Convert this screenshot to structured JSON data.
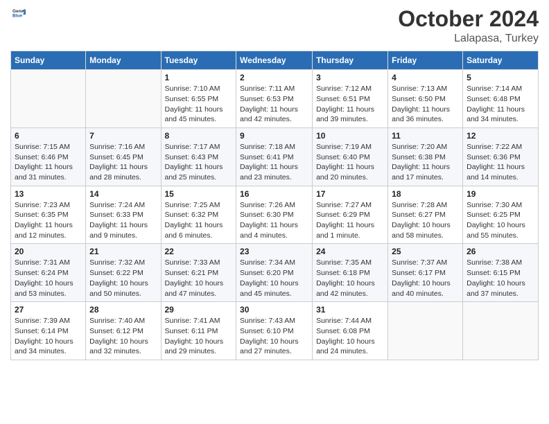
{
  "header": {
    "logo_general": "General",
    "logo_blue": "Blue",
    "title": "October 2024",
    "subtitle": "Lalapasa, Turkey"
  },
  "days_of_week": [
    "Sunday",
    "Monday",
    "Tuesday",
    "Wednesday",
    "Thursday",
    "Friday",
    "Saturday"
  ],
  "weeks": [
    [
      {
        "day": "",
        "info": ""
      },
      {
        "day": "",
        "info": ""
      },
      {
        "day": "1",
        "info": "Sunrise: 7:10 AM\nSunset: 6:55 PM\nDaylight: 11 hours and 45 minutes."
      },
      {
        "day": "2",
        "info": "Sunrise: 7:11 AM\nSunset: 6:53 PM\nDaylight: 11 hours and 42 minutes."
      },
      {
        "day": "3",
        "info": "Sunrise: 7:12 AM\nSunset: 6:51 PM\nDaylight: 11 hours and 39 minutes."
      },
      {
        "day": "4",
        "info": "Sunrise: 7:13 AM\nSunset: 6:50 PM\nDaylight: 11 hours and 36 minutes."
      },
      {
        "day": "5",
        "info": "Sunrise: 7:14 AM\nSunset: 6:48 PM\nDaylight: 11 hours and 34 minutes."
      }
    ],
    [
      {
        "day": "6",
        "info": "Sunrise: 7:15 AM\nSunset: 6:46 PM\nDaylight: 11 hours and 31 minutes."
      },
      {
        "day": "7",
        "info": "Sunrise: 7:16 AM\nSunset: 6:45 PM\nDaylight: 11 hours and 28 minutes."
      },
      {
        "day": "8",
        "info": "Sunrise: 7:17 AM\nSunset: 6:43 PM\nDaylight: 11 hours and 25 minutes."
      },
      {
        "day": "9",
        "info": "Sunrise: 7:18 AM\nSunset: 6:41 PM\nDaylight: 11 hours and 23 minutes."
      },
      {
        "day": "10",
        "info": "Sunrise: 7:19 AM\nSunset: 6:40 PM\nDaylight: 11 hours and 20 minutes."
      },
      {
        "day": "11",
        "info": "Sunrise: 7:20 AM\nSunset: 6:38 PM\nDaylight: 11 hours and 17 minutes."
      },
      {
        "day": "12",
        "info": "Sunrise: 7:22 AM\nSunset: 6:36 PM\nDaylight: 11 hours and 14 minutes."
      }
    ],
    [
      {
        "day": "13",
        "info": "Sunrise: 7:23 AM\nSunset: 6:35 PM\nDaylight: 11 hours and 12 minutes."
      },
      {
        "day": "14",
        "info": "Sunrise: 7:24 AM\nSunset: 6:33 PM\nDaylight: 11 hours and 9 minutes."
      },
      {
        "day": "15",
        "info": "Sunrise: 7:25 AM\nSunset: 6:32 PM\nDaylight: 11 hours and 6 minutes."
      },
      {
        "day": "16",
        "info": "Sunrise: 7:26 AM\nSunset: 6:30 PM\nDaylight: 11 hours and 4 minutes."
      },
      {
        "day": "17",
        "info": "Sunrise: 7:27 AM\nSunset: 6:29 PM\nDaylight: 11 hours and 1 minute."
      },
      {
        "day": "18",
        "info": "Sunrise: 7:28 AM\nSunset: 6:27 PM\nDaylight: 10 hours and 58 minutes."
      },
      {
        "day": "19",
        "info": "Sunrise: 7:30 AM\nSunset: 6:25 PM\nDaylight: 10 hours and 55 minutes."
      }
    ],
    [
      {
        "day": "20",
        "info": "Sunrise: 7:31 AM\nSunset: 6:24 PM\nDaylight: 10 hours and 53 minutes."
      },
      {
        "day": "21",
        "info": "Sunrise: 7:32 AM\nSunset: 6:22 PM\nDaylight: 10 hours and 50 minutes."
      },
      {
        "day": "22",
        "info": "Sunrise: 7:33 AM\nSunset: 6:21 PM\nDaylight: 10 hours and 47 minutes."
      },
      {
        "day": "23",
        "info": "Sunrise: 7:34 AM\nSunset: 6:20 PM\nDaylight: 10 hours and 45 minutes."
      },
      {
        "day": "24",
        "info": "Sunrise: 7:35 AM\nSunset: 6:18 PM\nDaylight: 10 hours and 42 minutes."
      },
      {
        "day": "25",
        "info": "Sunrise: 7:37 AM\nSunset: 6:17 PM\nDaylight: 10 hours and 40 minutes."
      },
      {
        "day": "26",
        "info": "Sunrise: 7:38 AM\nSunset: 6:15 PM\nDaylight: 10 hours and 37 minutes."
      }
    ],
    [
      {
        "day": "27",
        "info": "Sunrise: 7:39 AM\nSunset: 6:14 PM\nDaylight: 10 hours and 34 minutes."
      },
      {
        "day": "28",
        "info": "Sunrise: 7:40 AM\nSunset: 6:12 PM\nDaylight: 10 hours and 32 minutes."
      },
      {
        "day": "29",
        "info": "Sunrise: 7:41 AM\nSunset: 6:11 PM\nDaylight: 10 hours and 29 minutes."
      },
      {
        "day": "30",
        "info": "Sunrise: 7:43 AM\nSunset: 6:10 PM\nDaylight: 10 hours and 27 minutes."
      },
      {
        "day": "31",
        "info": "Sunrise: 7:44 AM\nSunset: 6:08 PM\nDaylight: 10 hours and 24 minutes."
      },
      {
        "day": "",
        "info": ""
      },
      {
        "day": "",
        "info": ""
      }
    ]
  ]
}
